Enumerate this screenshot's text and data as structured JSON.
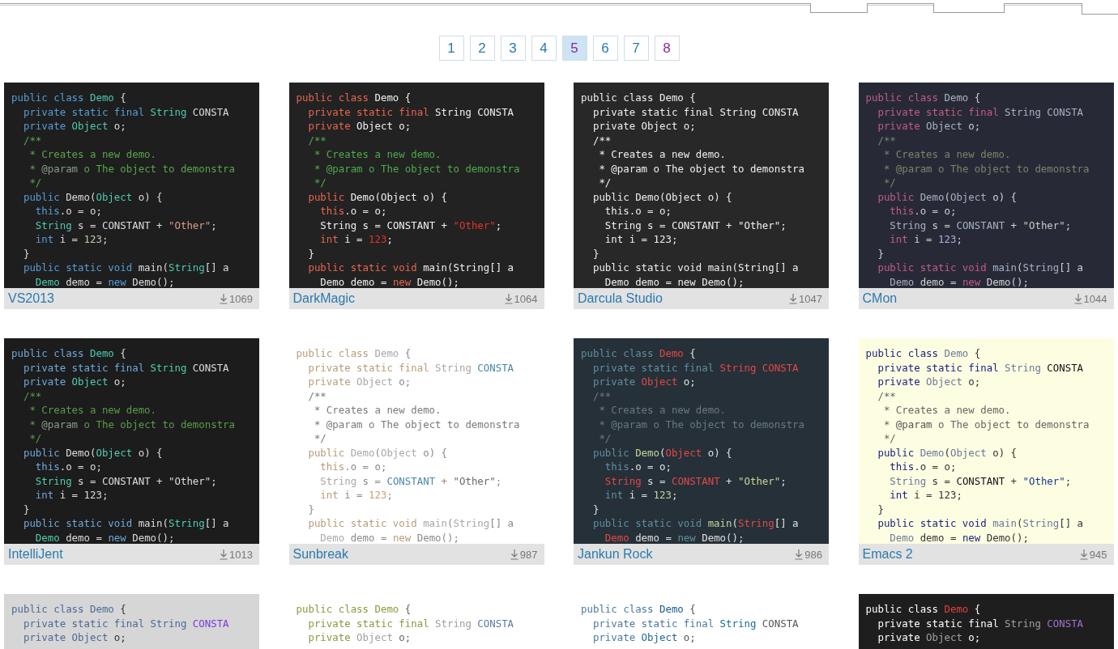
{
  "pagination": [
    {
      "label": "1",
      "selected": false,
      "visited": false
    },
    {
      "label": "2",
      "selected": false,
      "visited": false
    },
    {
      "label": "3",
      "selected": false,
      "visited": false
    },
    {
      "label": "4",
      "selected": false,
      "visited": false
    },
    {
      "label": "5",
      "selected": true,
      "visited": true
    },
    {
      "label": "6",
      "selected": false,
      "visited": false
    },
    {
      "label": "7",
      "selected": false,
      "visited": false
    },
    {
      "label": "8",
      "selected": false,
      "visited": true
    }
  ],
  "themes": [
    {
      "name": "VS2013",
      "downloads": "1069",
      "lines": [
        [
          {
            "text": "public class ",
            "kind": "keyword"
          },
          {
            "text": "Demo",
            "kind": "name"
          },
          {
            "text": " {",
            "kind": "plain"
          }
        ],
        [
          {
            "text": "  private static final ",
            "kind": "keyword"
          },
          {
            "text": "String",
            "kind": "type"
          },
          {
            "text": " CONSTA",
            "kind": "constant"
          }
        ],
        [
          {
            "text": "  private ",
            "kind": "keyword"
          },
          {
            "text": "Object",
            "kind": "type"
          },
          {
            "text": " o;",
            "kind": "plain"
          }
        ],
        [
          {
            "text": "  /**",
            "kind": "comment"
          }
        ],
        [
          {
            "text": "   * Creates a new demo.",
            "kind": "comment"
          }
        ],
        [
          {
            "text": "   * ",
            "kind": "comment"
          },
          {
            "text": "@param",
            "kind": "tag"
          },
          {
            "text": " o The object to demonstra",
            "kind": "comment"
          }
        ],
        [
          {
            "text": "   */",
            "kind": "comment"
          }
        ],
        [
          {
            "text": "  public ",
            "kind": "keyword"
          },
          {
            "text": "Demo",
            "kind": "function"
          },
          {
            "text": "(",
            "kind": "plain"
          },
          {
            "text": "Object",
            "kind": "type"
          },
          {
            "text": " o) {",
            "kind": "plain"
          }
        ],
        [
          {
            "text": "    this",
            "kind": "keyword"
          },
          {
            "text": ".o = o;",
            "kind": "plain"
          }
        ],
        [
          {
            "text": "    String",
            "kind": "type"
          },
          {
            "text": " s = ",
            "kind": "plain"
          },
          {
            "text": "CONSTANT",
            "kind": "constant"
          },
          {
            "text": " + ",
            "kind": "plain"
          },
          {
            "text": "\"Other\"",
            "kind": "string"
          },
          {
            "text": ";",
            "kind": "plain"
          }
        ],
        [
          {
            "text": "    int",
            "kind": "keyword"
          },
          {
            "text": " i = ",
            "kind": "plain"
          },
          {
            "text": "123",
            "kind": "number"
          },
          {
            "text": ";",
            "kind": "plain"
          }
        ],
        [
          {
            "text": "  }",
            "kind": "plain"
          }
        ],
        [
          {
            "text": "  public static void ",
            "kind": "keyword"
          },
          {
            "text": "main",
            "kind": "function"
          },
          {
            "text": "(",
            "kind": "plain"
          },
          {
            "text": "String",
            "kind": "type"
          },
          {
            "text": "[] a",
            "kind": "plain"
          }
        ],
        [
          {
            "text": "    Demo",
            "kind": "type"
          },
          {
            "text": " demo = ",
            "kind": "plain"
          },
          {
            "text": "new",
            "kind": "keyword"
          },
          {
            "text": " Demo();",
            "kind": "plain"
          }
        ]
      ]
    },
    {
      "name": "DarkMagic",
      "downloads": "1064",
      "lines": [
        [
          {
            "text": "public class ",
            "kind": "keyword"
          },
          {
            "text": "Demo",
            "kind": "name"
          },
          {
            "text": " {",
            "kind": "plain"
          }
        ],
        [
          {
            "text": "  private static final ",
            "kind": "keyword"
          },
          {
            "text": "String",
            "kind": "type"
          },
          {
            "text": " CONSTA",
            "kind": "constant"
          }
        ],
        [
          {
            "text": "  private ",
            "kind": "keyword"
          },
          {
            "text": "Object",
            "kind": "type"
          },
          {
            "text": " o;",
            "kind": "plain"
          }
        ],
        [
          {
            "text": "  /**",
            "kind": "comment"
          }
        ],
        [
          {
            "text": "   * Creates a new demo.",
            "kind": "comment"
          }
        ],
        [
          {
            "text": "   * ",
            "kind": "comment"
          },
          {
            "text": "@param",
            "kind": "tag"
          },
          {
            "text": " o The object to demonstra",
            "kind": "comment"
          }
        ],
        [
          {
            "text": "   */",
            "kind": "comment"
          }
        ],
        [
          {
            "text": "  public ",
            "kind": "keyword"
          },
          {
            "text": "Demo",
            "kind": "function"
          },
          {
            "text": "(",
            "kind": "plain"
          },
          {
            "text": "Object",
            "kind": "type"
          },
          {
            "text": " o) {",
            "kind": "plain"
          }
        ],
        [
          {
            "text": "    this",
            "kind": "keyword"
          },
          {
            "text": ".o = o;",
            "kind": "plain"
          }
        ],
        [
          {
            "text": "    String",
            "kind": "type"
          },
          {
            "text": " s = ",
            "kind": "plain"
          },
          {
            "text": "CONSTANT",
            "kind": "constant"
          },
          {
            "text": " + ",
            "kind": "plain"
          },
          {
            "text": "\"Other\"",
            "kind": "string"
          },
          {
            "text": ";",
            "kind": "plain"
          }
        ],
        [
          {
            "text": "    int",
            "kind": "keyword"
          },
          {
            "text": " i = ",
            "kind": "plain"
          },
          {
            "text": "123",
            "kind": "number"
          },
          {
            "text": ";",
            "kind": "plain"
          }
        ],
        [
          {
            "text": "  }",
            "kind": "plain"
          }
        ],
        [
          {
            "text": "  public static void ",
            "kind": "keyword"
          },
          {
            "text": "main",
            "kind": "function"
          },
          {
            "text": "(",
            "kind": "plain"
          },
          {
            "text": "String",
            "kind": "type"
          },
          {
            "text": "[] a",
            "kind": "plain"
          }
        ],
        [
          {
            "text": "    Demo",
            "kind": "type"
          },
          {
            "text": " demo = ",
            "kind": "plain"
          },
          {
            "text": "new",
            "kind": "keyword"
          },
          {
            "text": " Demo();",
            "kind": "plain"
          }
        ]
      ]
    },
    {
      "name": "Darcula Studio",
      "downloads": "1047",
      "lines": [
        [
          {
            "text": "public class ",
            "kind": "keyword"
          },
          {
            "text": "Demo",
            "kind": "name"
          },
          {
            "text": " {",
            "kind": "plain"
          }
        ],
        [
          {
            "text": "  private static final ",
            "kind": "keyword"
          },
          {
            "text": "String",
            "kind": "type"
          },
          {
            "text": " CONSTA",
            "kind": "constant"
          }
        ],
        [
          {
            "text": "  private ",
            "kind": "keyword"
          },
          {
            "text": "Object",
            "kind": "type"
          },
          {
            "text": " o;",
            "kind": "plain"
          }
        ],
        [
          {
            "text": "  /**",
            "kind": "comment"
          }
        ],
        [
          {
            "text": "   * Creates a new demo.",
            "kind": "comment"
          }
        ],
        [
          {
            "text": "   * ",
            "kind": "comment"
          },
          {
            "text": "@param",
            "kind": "tag"
          },
          {
            "text": " o The object to demonstra",
            "kind": "comment"
          }
        ],
        [
          {
            "text": "   */",
            "kind": "comment"
          }
        ],
        [
          {
            "text": "  public ",
            "kind": "keyword"
          },
          {
            "text": "Demo",
            "kind": "function"
          },
          {
            "text": "(",
            "kind": "plain"
          },
          {
            "text": "Object",
            "kind": "type"
          },
          {
            "text": " o) {",
            "kind": "plain"
          }
        ],
        [
          {
            "text": "    this",
            "kind": "keyword"
          },
          {
            "text": ".o = o;",
            "kind": "plain"
          }
        ],
        [
          {
            "text": "    String",
            "kind": "type"
          },
          {
            "text": " s = ",
            "kind": "plain"
          },
          {
            "text": "CONSTANT",
            "kind": "constant"
          },
          {
            "text": " + ",
            "kind": "plain"
          },
          {
            "text": "\"Other\"",
            "kind": "string"
          },
          {
            "text": ";",
            "kind": "plain"
          }
        ],
        [
          {
            "text": "    int",
            "kind": "keyword"
          },
          {
            "text": " i = ",
            "kind": "plain"
          },
          {
            "text": "123",
            "kind": "number"
          },
          {
            "text": ";",
            "kind": "plain"
          }
        ],
        [
          {
            "text": "  }",
            "kind": "plain"
          }
        ],
        [
          {
            "text": "  public static void ",
            "kind": "keyword"
          },
          {
            "text": "main",
            "kind": "function"
          },
          {
            "text": "(",
            "kind": "plain"
          },
          {
            "text": "String",
            "kind": "type"
          },
          {
            "text": "[] a",
            "kind": "plain"
          }
        ],
        [
          {
            "text": "    Demo",
            "kind": "type"
          },
          {
            "text": " demo = ",
            "kind": "plain"
          },
          {
            "text": "new",
            "kind": "keyword"
          },
          {
            "text": " Demo();",
            "kind": "plain"
          }
        ]
      ]
    },
    {
      "name": "CMon",
      "downloads": "1044",
      "lines": [
        [
          {
            "text": "public class ",
            "kind": "keyword"
          },
          {
            "text": "Demo",
            "kind": "name"
          },
          {
            "text": " {",
            "kind": "plain"
          }
        ],
        [
          {
            "text": "  private static final ",
            "kind": "keyword"
          },
          {
            "text": "String",
            "kind": "type"
          },
          {
            "text": " CONSTA",
            "kind": "constant"
          }
        ],
        [
          {
            "text": "  private ",
            "kind": "keyword"
          },
          {
            "text": "Object",
            "kind": "type"
          },
          {
            "text": " o;",
            "kind": "plain"
          }
        ],
        [
          {
            "text": "  /**",
            "kind": "comment"
          }
        ],
        [
          {
            "text": "   * Creates a new demo.",
            "kind": "comment"
          }
        ],
        [
          {
            "text": "   * ",
            "kind": "comment"
          },
          {
            "text": "@param",
            "kind": "tag"
          },
          {
            "text": " o The object to demonstra",
            "kind": "comment"
          }
        ],
        [
          {
            "text": "   */",
            "kind": "comment"
          }
        ],
        [
          {
            "text": "  public ",
            "kind": "keyword"
          },
          {
            "text": "Demo",
            "kind": "function"
          },
          {
            "text": "(",
            "kind": "plain"
          },
          {
            "text": "Object",
            "kind": "type"
          },
          {
            "text": " o) {",
            "kind": "plain"
          }
        ],
        [
          {
            "text": "    this",
            "kind": "keyword"
          },
          {
            "text": ".o = o;",
            "kind": "plain"
          }
        ],
        [
          {
            "text": "    String",
            "kind": "type"
          },
          {
            "text": " s = ",
            "kind": "plain"
          },
          {
            "text": "CONSTANT",
            "kind": "constant"
          },
          {
            "text": " + ",
            "kind": "plain"
          },
          {
            "text": "\"Other\"",
            "kind": "string"
          },
          {
            "text": ";",
            "kind": "plain"
          }
        ],
        [
          {
            "text": "    int",
            "kind": "keyword"
          },
          {
            "text": " i = ",
            "kind": "plain"
          },
          {
            "text": "123",
            "kind": "number"
          },
          {
            "text": ";",
            "kind": "plain"
          }
        ],
        [
          {
            "text": "  }",
            "kind": "plain"
          }
        ],
        [
          {
            "text": "  public static void ",
            "kind": "keyword"
          },
          {
            "text": "main",
            "kind": "function"
          },
          {
            "text": "(",
            "kind": "plain"
          },
          {
            "text": "String",
            "kind": "type"
          },
          {
            "text": "[] a",
            "kind": "plain"
          }
        ],
        [
          {
            "text": "    Demo",
            "kind": "type"
          },
          {
            "text": " demo = ",
            "kind": "plain"
          },
          {
            "text": "new",
            "kind": "keyword"
          },
          {
            "text": " Demo();",
            "kind": "plain"
          }
        ]
      ]
    },
    {
      "name": "IntelliJent",
      "downloads": "1013",
      "lines": [
        [
          {
            "text": "public class ",
            "kind": "keyword"
          },
          {
            "text": "Demo",
            "kind": "name"
          },
          {
            "text": " {",
            "kind": "plain"
          }
        ],
        [
          {
            "text": "  private static final ",
            "kind": "keyword"
          },
          {
            "text": "String",
            "kind": "type"
          },
          {
            "text": " CONSTA",
            "kind": "constant"
          }
        ],
        [
          {
            "text": "  private ",
            "kind": "keyword"
          },
          {
            "text": "Object",
            "kind": "type"
          },
          {
            "text": " o;",
            "kind": "plain"
          }
        ],
        [
          {
            "text": "  /**",
            "kind": "comment"
          }
        ],
        [
          {
            "text": "   * Creates a new demo.",
            "kind": "comment"
          }
        ],
        [
          {
            "text": "   * ",
            "kind": "comment"
          },
          {
            "text": "@param",
            "kind": "tag"
          },
          {
            "text": " o The object to demonstra",
            "kind": "comment"
          }
        ],
        [
          {
            "text": "   */",
            "kind": "comment"
          }
        ],
        [
          {
            "text": "  public ",
            "kind": "keyword"
          },
          {
            "text": "Demo",
            "kind": "function"
          },
          {
            "text": "(",
            "kind": "plain"
          },
          {
            "text": "Object",
            "kind": "type"
          },
          {
            "text": " o) {",
            "kind": "plain"
          }
        ],
        [
          {
            "text": "    this",
            "kind": "keyword"
          },
          {
            "text": ".o = o;",
            "kind": "plain"
          }
        ],
        [
          {
            "text": "    String",
            "kind": "type"
          },
          {
            "text": " s = ",
            "kind": "plain"
          },
          {
            "text": "CONSTANT",
            "kind": "constant"
          },
          {
            "text": " + ",
            "kind": "plain"
          },
          {
            "text": "\"Other\"",
            "kind": "string"
          },
          {
            "text": ";",
            "kind": "plain"
          }
        ],
        [
          {
            "text": "    int",
            "kind": "keyword"
          },
          {
            "text": " i = ",
            "kind": "plain"
          },
          {
            "text": "123",
            "kind": "number"
          },
          {
            "text": ";",
            "kind": "plain"
          }
        ],
        [
          {
            "text": "  }",
            "kind": "plain"
          }
        ],
        [
          {
            "text": "  public static void ",
            "kind": "keyword"
          },
          {
            "text": "main",
            "kind": "function"
          },
          {
            "text": "(",
            "kind": "plain"
          },
          {
            "text": "String",
            "kind": "type"
          },
          {
            "text": "[] a",
            "kind": "plain"
          }
        ],
        [
          {
            "text": "    Demo",
            "kind": "type"
          },
          {
            "text": " demo = ",
            "kind": "plain"
          },
          {
            "text": "new",
            "kind": "keyword"
          },
          {
            "text": " Demo();",
            "kind": "plain"
          }
        ]
      ]
    },
    {
      "name": "Sunbreak",
      "downloads": "987",
      "lines": [
        [
          {
            "text": "public class ",
            "kind": "keyword"
          },
          {
            "text": "Demo",
            "kind": "name"
          },
          {
            "text": " {",
            "kind": "plain"
          }
        ],
        [
          {
            "text": "  private static final ",
            "kind": "keyword"
          },
          {
            "text": "String",
            "kind": "type"
          },
          {
            "text": " CONSTA",
            "kind": "constant"
          }
        ],
        [
          {
            "text": "  private ",
            "kind": "keyword"
          },
          {
            "text": "Object",
            "kind": "type"
          },
          {
            "text": " o;",
            "kind": "plain"
          }
        ],
        [
          {
            "text": "  /**",
            "kind": "comment"
          }
        ],
        [
          {
            "text": "   * Creates a new demo.",
            "kind": "comment"
          }
        ],
        [
          {
            "text": "   * ",
            "kind": "comment"
          },
          {
            "text": "@param",
            "kind": "tag"
          },
          {
            "text": " o The object to demonstra",
            "kind": "comment"
          }
        ],
        [
          {
            "text": "   */",
            "kind": "comment"
          }
        ],
        [
          {
            "text": "  public ",
            "kind": "keyword"
          },
          {
            "text": "Demo",
            "kind": "function"
          },
          {
            "text": "(",
            "kind": "plain"
          },
          {
            "text": "Object",
            "kind": "type"
          },
          {
            "text": " o) {",
            "kind": "plain"
          }
        ],
        [
          {
            "text": "    this",
            "kind": "keyword"
          },
          {
            "text": ".o = o;",
            "kind": "plain"
          }
        ],
        [
          {
            "text": "    String",
            "kind": "type"
          },
          {
            "text": " s = ",
            "kind": "plain"
          },
          {
            "text": "CONSTANT",
            "kind": "constant"
          },
          {
            "text": " + ",
            "kind": "plain"
          },
          {
            "text": "\"Other\"",
            "kind": "string"
          },
          {
            "text": ";",
            "kind": "plain"
          }
        ],
        [
          {
            "text": "    int",
            "kind": "keyword"
          },
          {
            "text": " i = ",
            "kind": "plain"
          },
          {
            "text": "123",
            "kind": "number"
          },
          {
            "text": ";",
            "kind": "plain"
          }
        ],
        [
          {
            "text": "  }",
            "kind": "plain"
          }
        ],
        [
          {
            "text": "  public static void ",
            "kind": "keyword"
          },
          {
            "text": "main",
            "kind": "function"
          },
          {
            "text": "(",
            "kind": "plain"
          },
          {
            "text": "String",
            "kind": "type"
          },
          {
            "text": "[] a",
            "kind": "plain"
          }
        ],
        [
          {
            "text": "    Demo",
            "kind": "type"
          },
          {
            "text": " demo = ",
            "kind": "plain"
          },
          {
            "text": "new",
            "kind": "keyword"
          },
          {
            "text": " Demo();",
            "kind": "plain"
          }
        ]
      ]
    },
    {
      "name": "Jankun Rock",
      "downloads": "986",
      "lines": [
        [
          {
            "text": "public class ",
            "kind": "keyword"
          },
          {
            "text": "Demo",
            "kind": "name"
          },
          {
            "text": " {",
            "kind": "plain"
          }
        ],
        [
          {
            "text": "  private static final ",
            "kind": "keyword"
          },
          {
            "text": "String",
            "kind": "type"
          },
          {
            "text": " CONSTA",
            "kind": "constant"
          }
        ],
        [
          {
            "text": "  private ",
            "kind": "keyword"
          },
          {
            "text": "Object",
            "kind": "type"
          },
          {
            "text": " o;",
            "kind": "plain"
          }
        ],
        [
          {
            "text": "  /**",
            "kind": "comment"
          }
        ],
        [
          {
            "text": "   * Creates a new demo.",
            "kind": "comment"
          }
        ],
        [
          {
            "text": "   * ",
            "kind": "comment"
          },
          {
            "text": "@param",
            "kind": "tag"
          },
          {
            "text": " o The object to demonstra",
            "kind": "comment"
          }
        ],
        [
          {
            "text": "   */",
            "kind": "comment"
          }
        ],
        [
          {
            "text": "  public ",
            "kind": "keyword"
          },
          {
            "text": "Demo",
            "kind": "function"
          },
          {
            "text": "(",
            "kind": "plain"
          },
          {
            "text": "Object",
            "kind": "type"
          },
          {
            "text": " o) {",
            "kind": "plain"
          }
        ],
        [
          {
            "text": "    this",
            "kind": "keyword"
          },
          {
            "text": ".o = o;",
            "kind": "plain"
          }
        ],
        [
          {
            "text": "    String",
            "kind": "type"
          },
          {
            "text": " s = ",
            "kind": "plain"
          },
          {
            "text": "CONSTANT",
            "kind": "constant"
          },
          {
            "text": " + ",
            "kind": "plain"
          },
          {
            "text": "\"Other\"",
            "kind": "string"
          },
          {
            "text": ";",
            "kind": "plain"
          }
        ],
        [
          {
            "text": "    int",
            "kind": "keyword"
          },
          {
            "text": " i = ",
            "kind": "plain"
          },
          {
            "text": "123",
            "kind": "number"
          },
          {
            "text": ";",
            "kind": "plain"
          }
        ],
        [
          {
            "text": "  }",
            "kind": "plain"
          }
        ],
        [
          {
            "text": "  public static void ",
            "kind": "keyword"
          },
          {
            "text": "main",
            "kind": "function"
          },
          {
            "text": "(",
            "kind": "plain"
          },
          {
            "text": "String",
            "kind": "type"
          },
          {
            "text": "[] a",
            "kind": "plain"
          }
        ],
        [
          {
            "text": "    Demo",
            "kind": "type"
          },
          {
            "text": " demo = ",
            "kind": "plain"
          },
          {
            "text": "new",
            "kind": "keyword"
          },
          {
            "text": " Demo();",
            "kind": "plain"
          }
        ]
      ]
    },
    {
      "name": "Emacs 2",
      "downloads": "945",
      "lines": [
        [
          {
            "text": "public class ",
            "kind": "keyword"
          },
          {
            "text": "Demo",
            "kind": "name"
          },
          {
            "text": " {",
            "kind": "plain"
          }
        ],
        [
          {
            "text": "  private static final ",
            "kind": "keyword"
          },
          {
            "text": "String",
            "kind": "type"
          },
          {
            "text": " CONSTA",
            "kind": "constant"
          }
        ],
        [
          {
            "text": "  private ",
            "kind": "keyword"
          },
          {
            "text": "Object",
            "kind": "type"
          },
          {
            "text": " o;",
            "kind": "plain"
          }
        ],
        [
          {
            "text": "  /**",
            "kind": "comment"
          }
        ],
        [
          {
            "text": "   * Creates a new demo.",
            "kind": "comment"
          }
        ],
        [
          {
            "text": "   * ",
            "kind": "comment"
          },
          {
            "text": "@param",
            "kind": "tag"
          },
          {
            "text": " o The object to demonstra",
            "kind": "comment"
          }
        ],
        [
          {
            "text": "   */",
            "kind": "comment"
          }
        ],
        [
          {
            "text": "  public ",
            "kind": "keyword"
          },
          {
            "text": "Demo",
            "kind": "function"
          },
          {
            "text": "(",
            "kind": "plain"
          },
          {
            "text": "Object",
            "kind": "type"
          },
          {
            "text": " o) {",
            "kind": "plain"
          }
        ],
        [
          {
            "text": "    this",
            "kind": "keyword"
          },
          {
            "text": ".o = o;",
            "kind": "plain"
          }
        ],
        [
          {
            "text": "    String",
            "kind": "type"
          },
          {
            "text": " s = ",
            "kind": "plain"
          },
          {
            "text": "CONSTANT",
            "kind": "constant"
          },
          {
            "text": " + ",
            "kind": "plain"
          },
          {
            "text": "\"Other\"",
            "kind": "string"
          },
          {
            "text": ";",
            "kind": "plain"
          }
        ],
        [
          {
            "text": "    int",
            "kind": "keyword"
          },
          {
            "text": " i = ",
            "kind": "plain"
          },
          {
            "text": "123",
            "kind": "number"
          },
          {
            "text": ";",
            "kind": "plain"
          }
        ],
        [
          {
            "text": "  }",
            "kind": "plain"
          }
        ],
        [
          {
            "text": "  public static void ",
            "kind": "keyword"
          },
          {
            "text": "main",
            "kind": "function"
          },
          {
            "text": "(",
            "kind": "plain"
          },
          {
            "text": "String",
            "kind": "type"
          },
          {
            "text": "[] a",
            "kind": "plain"
          }
        ],
        [
          {
            "text": "    Demo",
            "kind": "type"
          },
          {
            "text": " demo = ",
            "kind": "plain"
          },
          {
            "text": "new",
            "kind": "keyword"
          },
          {
            "text": " Demo();",
            "kind": "plain"
          }
        ]
      ]
    },
    {
      "lines": [
        [
          {
            "text": "public class ",
            "kind": "keyword"
          },
          {
            "text": "Demo",
            "kind": "name"
          },
          {
            "text": " {",
            "kind": "plain"
          }
        ],
        [
          {
            "text": "  private static final ",
            "kind": "keyword"
          },
          {
            "text": "String",
            "kind": "type"
          },
          {
            "text": " CONSTA",
            "kind": "constant"
          }
        ],
        [
          {
            "text": "  private ",
            "kind": "keyword"
          },
          {
            "text": "Object",
            "kind": "type"
          },
          {
            "text": " o;",
            "kind": "plain"
          }
        ]
      ]
    },
    {
      "lines": [
        [
          {
            "text": "public class ",
            "kind": "keyword"
          },
          {
            "text": "Demo",
            "kind": "name"
          },
          {
            "text": " {",
            "kind": "plain"
          }
        ],
        [
          {
            "text": "  private static final ",
            "kind": "keyword"
          },
          {
            "text": "String",
            "kind": "type"
          },
          {
            "text": " CONSTA",
            "kind": "constant"
          }
        ],
        [
          {
            "text": "  private ",
            "kind": "keyword"
          },
          {
            "text": "Object",
            "kind": "type"
          },
          {
            "text": " o;",
            "kind": "plain"
          }
        ]
      ]
    },
    {
      "lines": [
        [
          {
            "text": "public class ",
            "kind": "keyword"
          },
          {
            "text": "Demo",
            "kind": "name"
          },
          {
            "text": " {",
            "kind": "plain"
          }
        ],
        [
          {
            "text": "  private static final ",
            "kind": "keyword"
          },
          {
            "text": "String",
            "kind": "type"
          },
          {
            "text": " CONSTA",
            "kind": "constant"
          }
        ],
        [
          {
            "text": "  private ",
            "kind": "keyword"
          },
          {
            "text": "Object",
            "kind": "type"
          },
          {
            "text": " o;",
            "kind": "plain"
          }
        ]
      ]
    },
    {
      "lines": [
        [
          {
            "text": "public class ",
            "kind": "keyword"
          },
          {
            "text": "Demo",
            "kind": "name"
          },
          {
            "text": " {",
            "kind": "plain"
          }
        ],
        [
          {
            "text": "  private static final ",
            "kind": "keyword"
          },
          {
            "text": "String",
            "kind": "type"
          },
          {
            "text": " CONSTA",
            "kind": "constant"
          }
        ],
        [
          {
            "text": "  private ",
            "kind": "keyword"
          },
          {
            "text": "Object",
            "kind": "type"
          },
          {
            "text": " o;",
            "kind": "plain"
          }
        ]
      ]
    }
  ]
}
